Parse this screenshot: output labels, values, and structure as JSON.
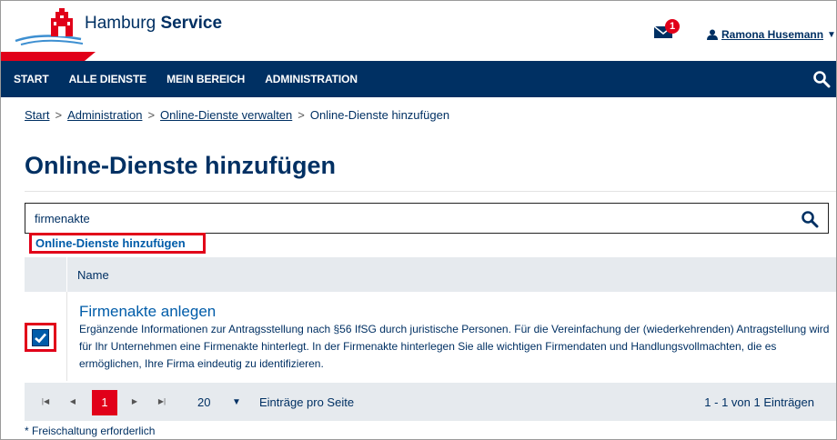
{
  "header": {
    "brand_prefix": "Hamburg",
    "brand_suffix": "Service",
    "mail_count": "1",
    "user_name": "Ramona Husemann"
  },
  "nav": {
    "items": [
      "START",
      "ALLE DIENSTE",
      "MEIN BEREICH",
      "ADMINISTRATION"
    ]
  },
  "breadcrumb": {
    "items": [
      "Start",
      "Administration",
      "Online-Dienste verwalten",
      "Online-Dienste hinzufügen"
    ],
    "separator": ">"
  },
  "page": {
    "title": "Online-Dienste hinzufügen"
  },
  "search": {
    "value": "firmenakte"
  },
  "add_link": "Online-Dienste hinzufügen",
  "table": {
    "header_name": "Name",
    "rows": [
      {
        "title": "Firmenakte anlegen",
        "description": "Ergänzende Informationen zur Antragsstellung nach §56 IfSG durch juristische Personen. Für die Vereinfachung der (wiederkehrenden) Antragstellung wird für Ihr Unternehmen eine Firmenakte hinterlegt. In der Firmenakte hinterlegen Sie alle wichtigen Firmendaten und Handlungsvollmachten, die es ermöglichen, Ihre Firma eindeutig zu identifizieren.",
        "checked": true
      }
    ]
  },
  "pager": {
    "current_page": "1",
    "page_size": "20",
    "page_size_label": "Einträge pro Seite",
    "info": "1 - 1 von 1 Einträgen"
  },
  "footnote": "* Freischaltung erforderlich",
  "colors": {
    "navy": "#003063",
    "red": "#e10019",
    "link_blue": "#005ca9",
    "table_grey": "#e6eaee"
  }
}
